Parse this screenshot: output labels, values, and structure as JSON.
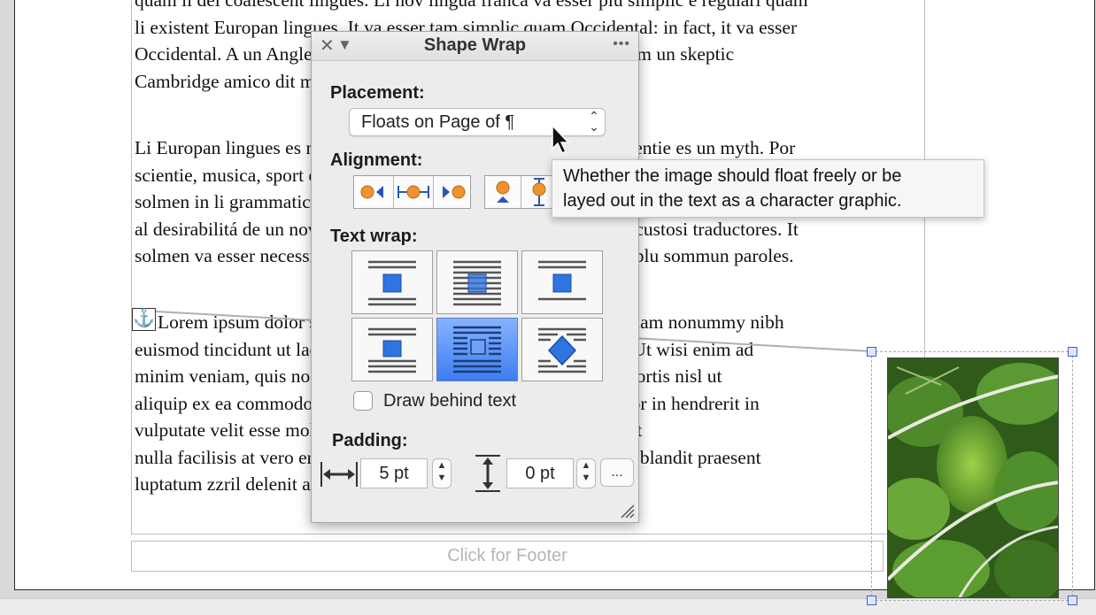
{
  "document": {
    "paragraph1": [
      "quam li del coalescent lingues. Li nov lingua franca va esser plu simplic e regulari quam",
      "li existent Europan lingues. It va esser tam simplic quam Occidental: in fact, it va esser",
      "Occidental. A un Angleso it va semblar un simplificat Angles, quam un skeptic",
      "Cambridge amico dit me que Occidental es."
    ],
    "paragraph2": [
      "Li Europan lingues es membres del sam familie. Lor separat existentie es un myth. Por",
      "scientie, musica, sport etc, litot Europa usa li sam vocabular. Li lingues differe",
      "solmen in li grammatica, li pronunciation e li plu commun vocabules. Omnicos directe",
      "al desirabilitá de un nov lingua franca: On refusa continuar payar custosi traductores. It",
      "solmen va esser necessi far uniform grammatica, pronunciation e plu sommun paroles."
    ],
    "paragraph3": [
      "Lorem ipsum dolor sit amet, consectetuer adipiscing elit, sed diam nonummy nibh",
      "euismod tincidunt ut laoreet dolore magna aliquam erat volutpat. Ut wisi enim ad",
      "minim veniam, quis nostrud exerci tation ullamcorper suscipit lobortis nisl ut",
      "aliquip ex ea commodo consequat. Duis autem vel eum iriure dolor in hendrerit in",
      "vulputate velit esse molestie consequat, vel illum dolore eu feugiat",
      "nulla facilisis at vero eros et accumsan et iusto odio dignissim qui blandit praesent",
      "luptatum zzril delenit augue duis dolore te feugait nulla facilisi."
    ],
    "anchor_glyph": "⚓",
    "footer_placeholder": "Click for Footer"
  },
  "panel": {
    "title": "Shape Wrap",
    "close_glyph": "✕",
    "collapse_glyph": "▼",
    "more_glyph": "•••",
    "placement_label": "Placement:",
    "placement_value": "Floats on Page of ¶",
    "alignment_label": "Alignment:",
    "text_wrap_label": "Text wrap:",
    "text_wrap_selected": "wrap-around-shape",
    "draw_behind_label": "Draw behind text",
    "draw_behind_checked": false,
    "padding_label": "Padding:",
    "padding_horizontal": "5 pt",
    "padding_vertical": "0 pt",
    "padding_more": "..."
  },
  "tooltip": {
    "line1": "Whether the image should float freely or be",
    "line2": "layed out in the text as a character graphic."
  },
  "colors": {
    "accent_blue": "#3d7df0",
    "orange_dot": "#f0932b",
    "handle_blue": "#4060d0"
  }
}
